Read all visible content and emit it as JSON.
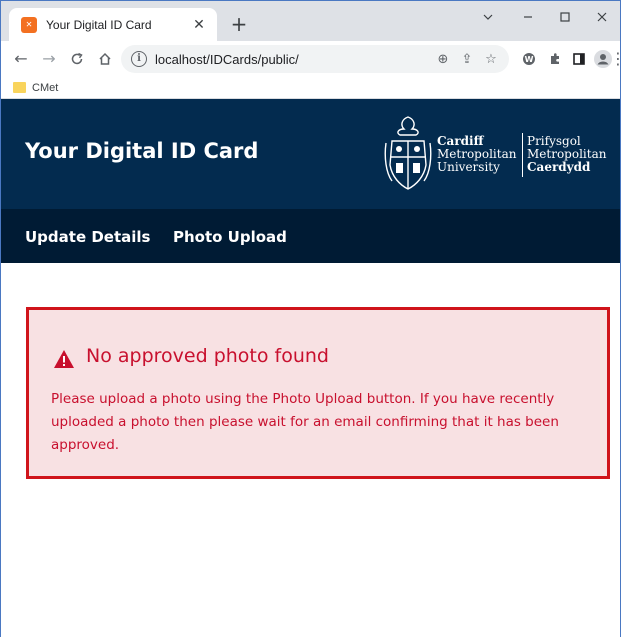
{
  "browser": {
    "tab": {
      "title": "Your Digital ID Card",
      "favicon": "xampp-icon"
    },
    "window_controls": [
      "chevron-down-icon",
      "minimize-icon",
      "maximize-icon",
      "close-icon"
    ],
    "toolbar": {
      "url": "localhost/IDCards/public/",
      "buttons": [
        "back-icon",
        "forward-icon",
        "reload-icon",
        "home-icon",
        "zoom-icon",
        "share-icon",
        "star-icon",
        "extension-w-icon",
        "puzzle-icon",
        "sidepanel-icon",
        "profile-icon",
        "menu-icon"
      ]
    },
    "bookmarks": [
      {
        "label": "CMet",
        "icon": "folder-icon"
      }
    ]
  },
  "site": {
    "title": "Your Digital ID Card",
    "logo": {
      "english": [
        "Cardiff",
        "Metropolitan",
        "University"
      ],
      "welsh": [
        "Prifysgol",
        "Metropolitan",
        "Caerdydd"
      ]
    },
    "nav": [
      {
        "label": "Update Details"
      },
      {
        "label": "Photo Upload"
      }
    ]
  },
  "alert": {
    "title": "No approved photo found",
    "message": "Please upload a photo using the Photo Upload button. If you have recently uploaded a photo then please wait for an email confirming that it has been approved.",
    "colors": {
      "border": "#d0141b",
      "background": "#f8e1e3",
      "text": "#c8102e"
    }
  },
  "colors": {
    "header": "#032b4f",
    "nav": "#001b34"
  }
}
